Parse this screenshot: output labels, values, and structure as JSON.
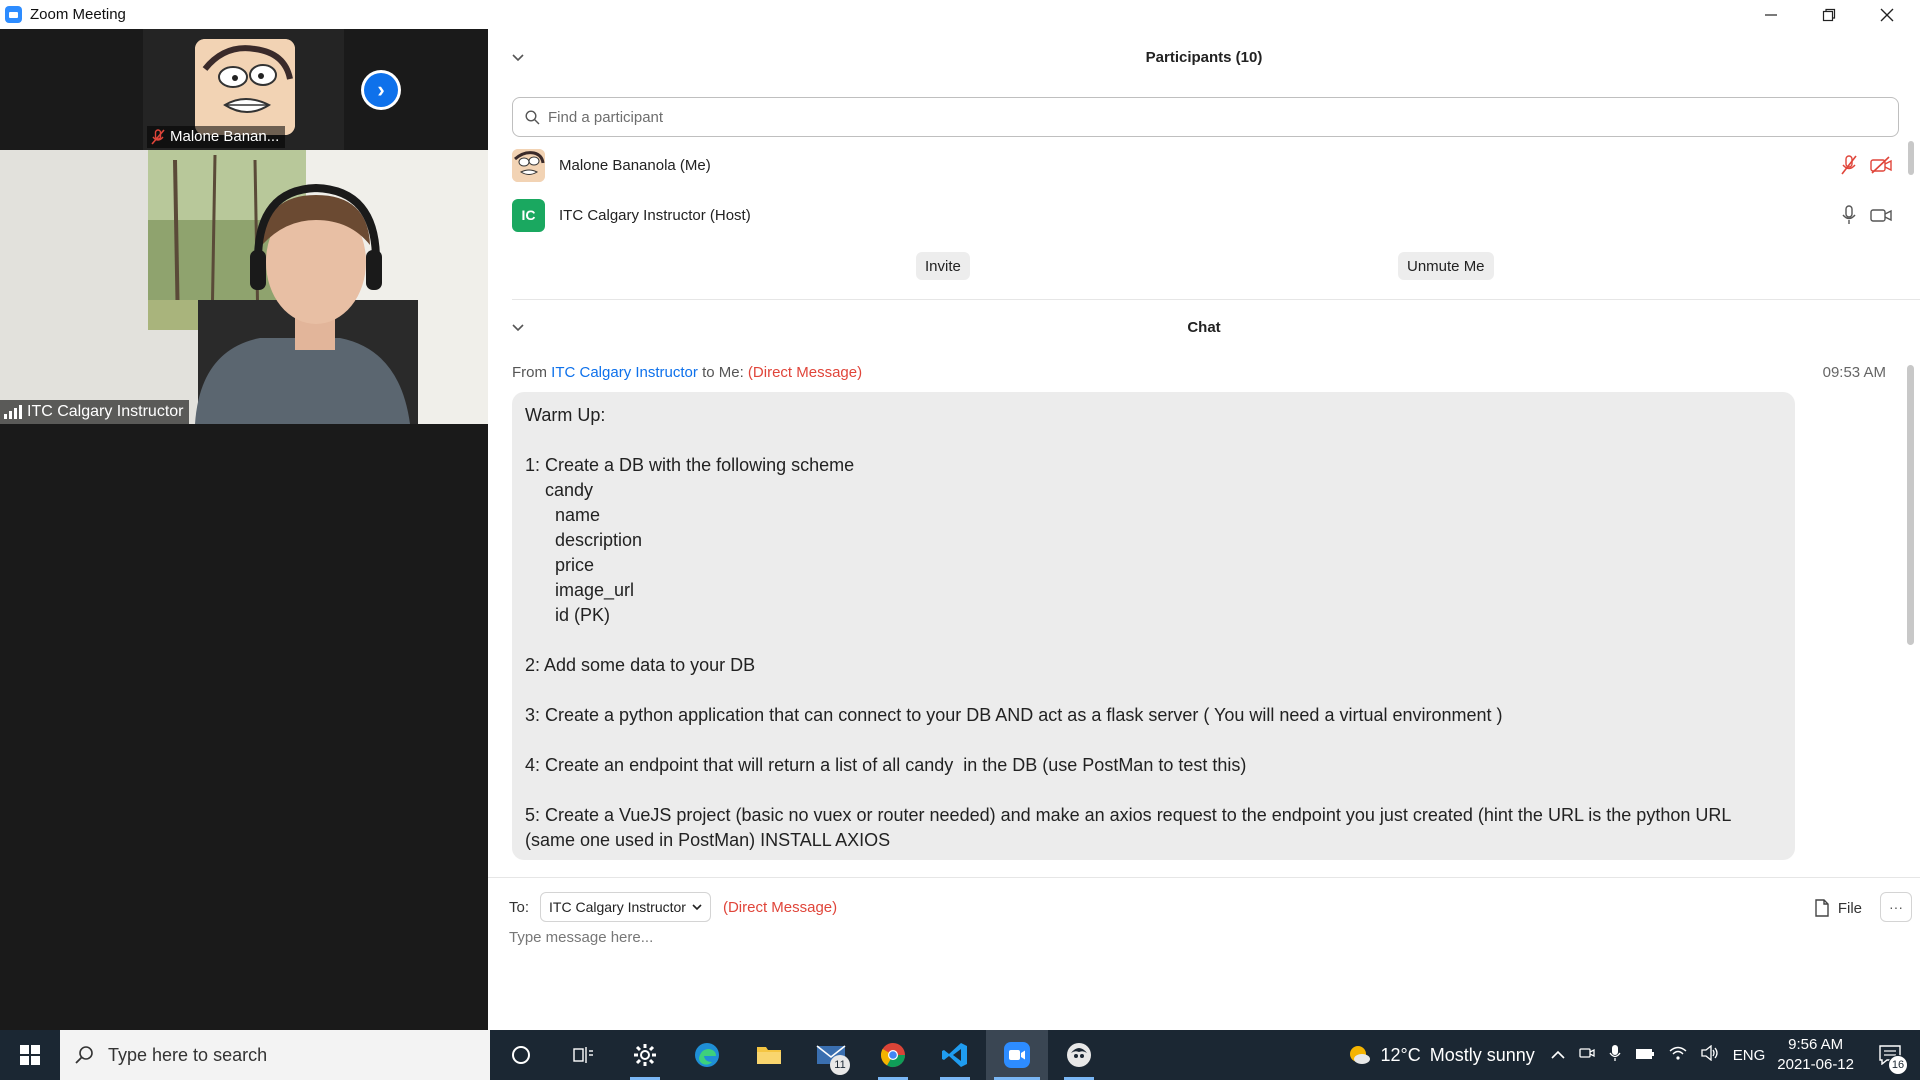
{
  "window": {
    "title": "Zoom Meeting"
  },
  "video": {
    "thumb_name": "Malone Banan...",
    "main_name": "ITC Calgary Instructor"
  },
  "participants": {
    "header": "Participants (10)",
    "search_placeholder": "Find a participant",
    "list": [
      {
        "name": "Malone Bananola (Me)",
        "avatar": "cartoon-image",
        "mic": "muted",
        "video": "off"
      },
      {
        "name": "ITC Calgary Instructor (Host)",
        "initials": "IC",
        "mic": "on",
        "video": "on"
      }
    ],
    "invite_label": "Invite",
    "unmute_label": "Unmute Me"
  },
  "chat": {
    "header": "Chat",
    "message": {
      "from_prefix": "From",
      "sender": "ITC Calgary Instructor",
      "to_text": "to Me:",
      "dm_label": "(Direct Message)",
      "time": "09:53 AM",
      "lines": [
        "Warm Up:",
        "",
        "1: Create a DB with the following scheme",
        "    candy",
        "      name",
        "      description",
        "      price",
        "      image_url",
        "      id (PK)",
        "",
        "2: Add some data to your DB",
        "",
        "3: Create a python application that can connect to your DB AND act as a flask server ( You will need a virtual environment )",
        "",
        "4: Create an endpoint that will return a list of all candy  in the DB (use PostMan to test this)",
        "",
        "5: Create a VueJS project (basic no vuex or router needed) and make an axios request to the endpoint you just created (hint the URL is the python URL (same one used in PostMan) INSTALL AXIOS"
      ]
    },
    "compose": {
      "to_label": "To:",
      "recipient": "ITC Calgary Instructor",
      "dm_label": "(Direct Message)",
      "file_label": "File",
      "more_label": "···",
      "placeholder": "Type message here..."
    }
  },
  "taskbar": {
    "search_placeholder": "Type here to search",
    "mail_badge": "11",
    "weather_temp": "12°C",
    "weather_text": "Mostly sunny",
    "language": "ENG",
    "time": "9:56 AM",
    "date": "2021-06-12",
    "notification_count": "16"
  },
  "colors": {
    "zoom_blue": "#0e71eb",
    "dm_red": "#e0453a",
    "host_green": "#1aa860",
    "taskbar_bg": "#1b2733"
  }
}
